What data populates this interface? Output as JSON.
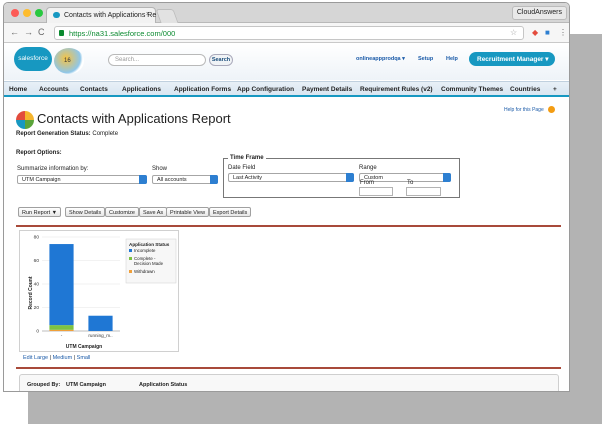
{
  "browser": {
    "tab_title": "Contacts with Applications Re",
    "tab_close": "×",
    "profile": "CloudAnswers",
    "url": "https://na31.salesforce.com/000"
  },
  "header": {
    "logo_text": "salesforce",
    "logo_badge": "16",
    "search_placeholder": "Search...",
    "search_button": "Search",
    "user_menu": "onlineappprodqa ▾",
    "setup": "Setup",
    "help": "Help",
    "app_button": "Recruitment Manager ▾"
  },
  "nav": {
    "tabs": [
      "Home",
      "Accounts",
      "Contacts",
      "Applications",
      "Application Forms",
      "App Configuration",
      "Payment Details",
      "Requirement Rules (v2)",
      "Community Themes",
      "Countries",
      "+"
    ]
  },
  "report": {
    "help_for_page": "Help for this Page",
    "title": "Contacts with Applications Report",
    "gen_status_label": "Report Generation Status:",
    "gen_status_value": "Complete",
    "options_title": "Report Options:",
    "summarize_label": "Summarize information by:",
    "summarize_value": "UTM Campaign",
    "show_label": "Show",
    "show_value": "All accounts",
    "timeframe_title": "Time Frame",
    "date_field_label": "Date Field",
    "date_field_value": "Last Activity",
    "range_label": "Range",
    "range_value": "Custom",
    "from_label": "From",
    "to_label": "To",
    "buttons": [
      "Run Report ▼",
      "Show Details",
      "Customize",
      "Save As",
      "Printable View",
      "Export Details"
    ],
    "grouped_by_label": "Grouped By:",
    "grouped_by_value": "UTM Campaign",
    "grouped_col2": "Application Status"
  },
  "chart_links": {
    "edit": "Edit",
    "large": "Large",
    "medium": "Medium",
    "small": "Small"
  },
  "chart_data": {
    "type": "bar",
    "stacked": true,
    "categories": [
      "-",
      "running_m.."
    ],
    "series": [
      {
        "name": "Incomplete",
        "color": "#1f77d4",
        "values": [
          69,
          13
        ]
      },
      {
        "name": "Complete - Decision Made",
        "color": "#7dc242",
        "values": [
          4,
          0
        ]
      },
      {
        "name": "Withdrawn",
        "color": "#f0a03a",
        "values": [
          1,
          0
        ]
      }
    ],
    "legend_title": "Application Status",
    "xlabel": "UTM Campaign",
    "ylabel": "Record Count",
    "yticks": [
      0,
      20,
      40,
      60,
      80
    ],
    "ylim": [
      0,
      80
    ],
    "legend_placement": "right"
  },
  "colors": {
    "brand": "#1798c1",
    "accent_rule": "#a84a3a",
    "link": "#1a5aa8"
  }
}
